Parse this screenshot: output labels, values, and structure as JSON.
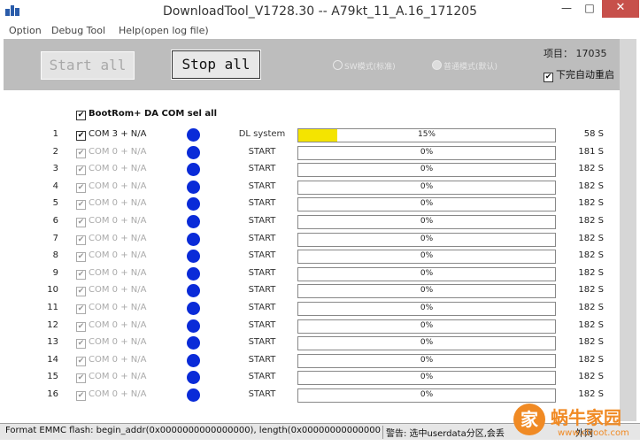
{
  "window": {
    "title": "DownloadTool_V1728.30 -- A79kt_11_A.16_171205",
    "min": "—",
    "max": "□",
    "close": "✕"
  },
  "menu": [
    "Option",
    "Debug Tool",
    "Help(open log file)"
  ],
  "toolbar": {
    "start_label": "Start all",
    "stop_label": "Stop all",
    "radio1": "SW模式(标准)",
    "radio2": "普通模式(默认)",
    "project_label": "项目：",
    "project_value": "17035",
    "auto_restart_label": "下完自动重启",
    "auto_restart_checked": "✔"
  },
  "select_all": {
    "check": "✔",
    "label": "BootRom+ DA COM sel all"
  },
  "rows": [
    {
      "n": "1",
      "com": "COM 3 + N/A",
      "status": "DL system",
      "progress": 15,
      "pct": "15%",
      "time": "58 S",
      "enabled": true
    },
    {
      "n": "2",
      "com": "COM 0 + N/A",
      "status": "START",
      "progress": 0,
      "pct": "0%",
      "time": "181 S",
      "enabled": false
    },
    {
      "n": "3",
      "com": "COM 0 + N/A",
      "status": "START",
      "progress": 0,
      "pct": "0%",
      "time": "182 S",
      "enabled": false
    },
    {
      "n": "4",
      "com": "COM 0 + N/A",
      "status": "START",
      "progress": 0,
      "pct": "0%",
      "time": "182 S",
      "enabled": false
    },
    {
      "n": "5",
      "com": "COM 0 + N/A",
      "status": "START",
      "progress": 0,
      "pct": "0%",
      "time": "182 S",
      "enabled": false
    },
    {
      "n": "6",
      "com": "COM 0 + N/A",
      "status": "START",
      "progress": 0,
      "pct": "0%",
      "time": "182 S",
      "enabled": false
    },
    {
      "n": "7",
      "com": "COM 0 + N/A",
      "status": "START",
      "progress": 0,
      "pct": "0%",
      "time": "182 S",
      "enabled": false
    },
    {
      "n": "8",
      "com": "COM 0 + N/A",
      "status": "START",
      "progress": 0,
      "pct": "0%",
      "time": "182 S",
      "enabled": false
    },
    {
      "n": "9",
      "com": "COM 0 + N/A",
      "status": "START",
      "progress": 0,
      "pct": "0%",
      "time": "182 S",
      "enabled": false
    },
    {
      "n": "10",
      "com": "COM 0 + N/A",
      "status": "START",
      "progress": 0,
      "pct": "0%",
      "time": "182 S",
      "enabled": false
    },
    {
      "n": "11",
      "com": "COM 0 + N/A",
      "status": "START",
      "progress": 0,
      "pct": "0%",
      "time": "182 S",
      "enabled": false
    },
    {
      "n": "12",
      "com": "COM 0 + N/A",
      "status": "START",
      "progress": 0,
      "pct": "0%",
      "time": "182 S",
      "enabled": false
    },
    {
      "n": "13",
      "com": "COM 0 + N/A",
      "status": "START",
      "progress": 0,
      "pct": "0%",
      "time": "182 S",
      "enabled": false
    },
    {
      "n": "14",
      "com": "COM 0 + N/A",
      "status": "START",
      "progress": 0,
      "pct": "0%",
      "time": "182 S",
      "enabled": false
    },
    {
      "n": "15",
      "com": "COM 0 + N/A",
      "status": "START",
      "progress": 0,
      "pct": "0%",
      "time": "182 S",
      "enabled": false
    },
    {
      "n": "16",
      "com": "COM 0 + N/A",
      "status": "START",
      "progress": 0,
      "pct": "0%",
      "time": "182 S",
      "enabled": false
    }
  ],
  "status_bar": {
    "left": "Format EMMC flash:  begin_addr(0x0000000000000000), length(0x00000000000000",
    "right": "警告: 选中userdata分区,会丢",
    "tail": "外网"
  },
  "watermark": {
    "glyph": "家",
    "text": "蜗牛家园",
    "url": "www.ctroot.com"
  },
  "colors": {
    "led": "#0a2bd8",
    "progress_fill": "#f4e400",
    "toolbar_bg": "#bdbdbd",
    "close_btn": "#c7504b"
  }
}
